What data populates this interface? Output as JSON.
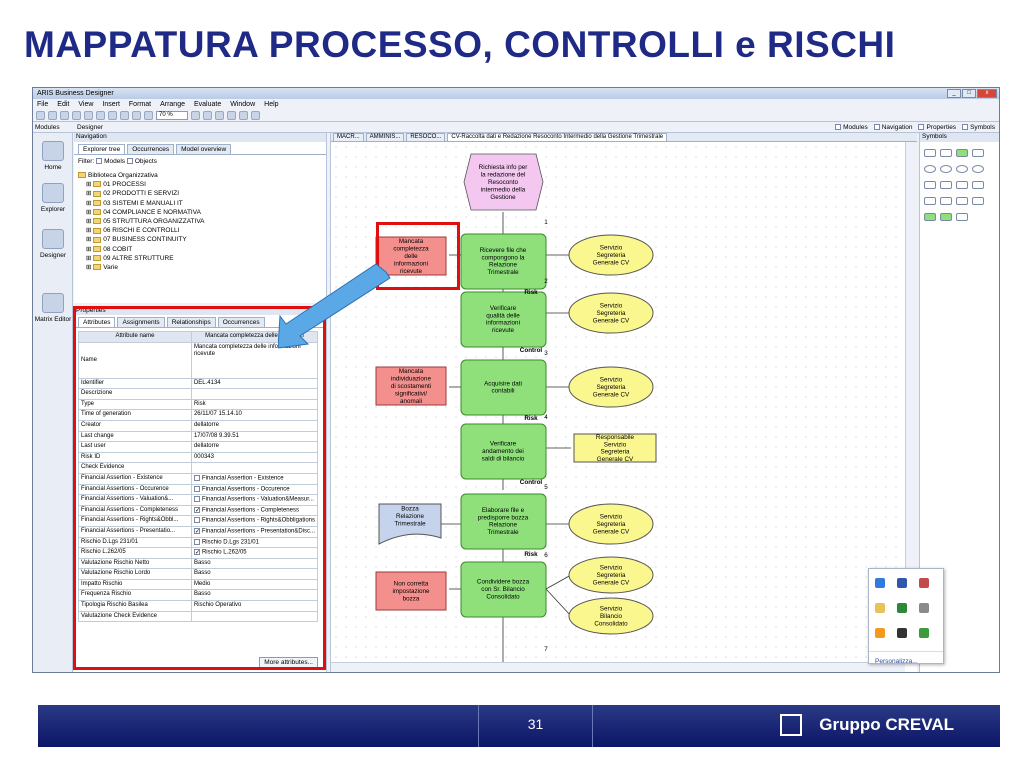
{
  "slide": {
    "title": "MAPPATURA PROCESSO, CONTROLLI e RISCHI",
    "page_number": "31",
    "brand": "Gruppo CREVAL"
  },
  "app": {
    "window_title": "ARIS Business Designer",
    "menu": [
      "File",
      "Edit",
      "View",
      "Insert",
      "Format",
      "Arrange",
      "Evaluate",
      "Window",
      "Help"
    ],
    "zoom": "70 %",
    "left_panel": "Modules",
    "designer_label": "Designer",
    "checks": [
      "Modules",
      "Navigation",
      "Properties",
      "Symbols"
    ]
  },
  "leftnav": [
    "Home",
    "Explorer",
    "Designer",
    "Matrix Editor"
  ],
  "navigation": {
    "title": "Navigation",
    "tabs": [
      "Explorer tree",
      "Occurrences",
      "Model overview"
    ],
    "filter": "Filter:",
    "filter_models": "Models",
    "filter_objects": "Objects",
    "tree": [
      "Biblioteca Organizzativa",
      "01 PROCESSI",
      "02 PRODOTTI E SERVIZI",
      "03 SISTEMI E MANUALI IT",
      "04 COMPLIANCE E NORMATIVA",
      "05 STRUTTURA ORGANIZZATIVA",
      "06 RISCHI E CONTROLLI",
      "07 BUSINESS CONTINUITY",
      "08 COBIT",
      "09 ALTRE STRUTTURE",
      "Varie"
    ]
  },
  "properties": {
    "title": "Properties",
    "tabs": [
      "Attributes",
      "Assignments",
      "Relationships",
      "Occurrences"
    ],
    "col_name": "Attribute name",
    "col_value": "Mancata completezza delle informazi",
    "rows": [
      [
        "Name",
        "Mancata completezza delle informazioni ricevute"
      ],
      [
        "Identifier",
        "DEL.4134"
      ],
      [
        "Descrizione",
        ""
      ],
      [
        "Type",
        "Risk"
      ],
      [
        "Time of generation",
        "26/11/07 15.14.10"
      ],
      [
        "Creator",
        "dellatorre"
      ],
      [
        "Last change",
        "17/07/08 9.39.51"
      ],
      [
        "Last user",
        "dellatorre"
      ],
      [
        "Risk ID",
        "000343"
      ],
      [
        "Check Evidence",
        ""
      ],
      [
        "Financial Assertion - Existence",
        "Financial Assertion - Existence"
      ],
      [
        "Financial Assertions - Occurence",
        "Financial Assertions - Occurence"
      ],
      [
        "Financial Assertions - Valuation&...",
        "Financial Assertions - Valuation&Measur..."
      ],
      [
        "Financial Assertions - Completeness",
        "Financial Assertions - Completeness"
      ],
      [
        "Financial Assertions - Rights&Obbl...",
        "Financial Assertions - Rights&Obbligations"
      ],
      [
        "Financial Assertions - Presentatio...",
        "Financial Assertions - Presentation&Disc..."
      ],
      [
        "Rischio D.Lgs 231/01",
        "Rischio D.Lgs 231/01"
      ],
      [
        "Rischio L.262/05",
        "Rischio L.262/05"
      ],
      [
        "Valutazione Rischio Netto",
        "Basso"
      ],
      [
        "Valutazione Rischio Lordo",
        "Basso"
      ],
      [
        "Impatto Rischio",
        "Medio"
      ],
      [
        "Frequenza Rischio",
        "Basso"
      ],
      [
        "Tipologia Rischio Basilea",
        "Rischio Operativo"
      ],
      [
        "Valutazione Check Evidence",
        ""
      ]
    ],
    "more": "More attributes..."
  },
  "canvas": {
    "tabs": [
      "MACR...",
      "AMMINIS...",
      "RESOCO...",
      "CV-Raccolta dati e Redazione Resoconto Intermedio della Gestione Trimestrale"
    ],
    "start": "Richiesta info per la redazione del Resoconto intermedio della Gestione",
    "steps": [
      "Ricevere file che compongono la Relazione Trimestrale",
      "Verificare qualità delle informazioni ricevute",
      "Acquisire dati contabili",
      "Verificare andamento dei saldi di bilancio",
      "Elaborare file e predisporre bozza Relazione Trimestrale",
      "Condividere bozza con Sr. Bilancio Consolidato"
    ],
    "risks": [
      "Mancata completezza delle informazioni ricevute",
      "Mancata individuazione di scostamenti significativi/ anomali",
      "Non corretta impostazione bozza"
    ],
    "actors": [
      "Servizio Segreteria Generale CV",
      "Servizio Segreteria Generale CV",
      "Servizio Segreteria Generale CV",
      "Servizio Segreteria Generale CV",
      "Servizio Segreteria Generale CV",
      "Servizio Bilancio Consolidato"
    ],
    "responsabile": "Responsabile Servizio Segreteria Generale CV",
    "document": "Bozza Relazione Trimestrale",
    "labels": [
      "Risk",
      "Control",
      "Risk",
      "Control",
      "Risk"
    ],
    "numbers": [
      "1",
      "2",
      "3",
      "4",
      "5",
      "6",
      "7"
    ]
  },
  "symbols": {
    "title": "Symbols",
    "popup_link": "Personalizza..."
  }
}
